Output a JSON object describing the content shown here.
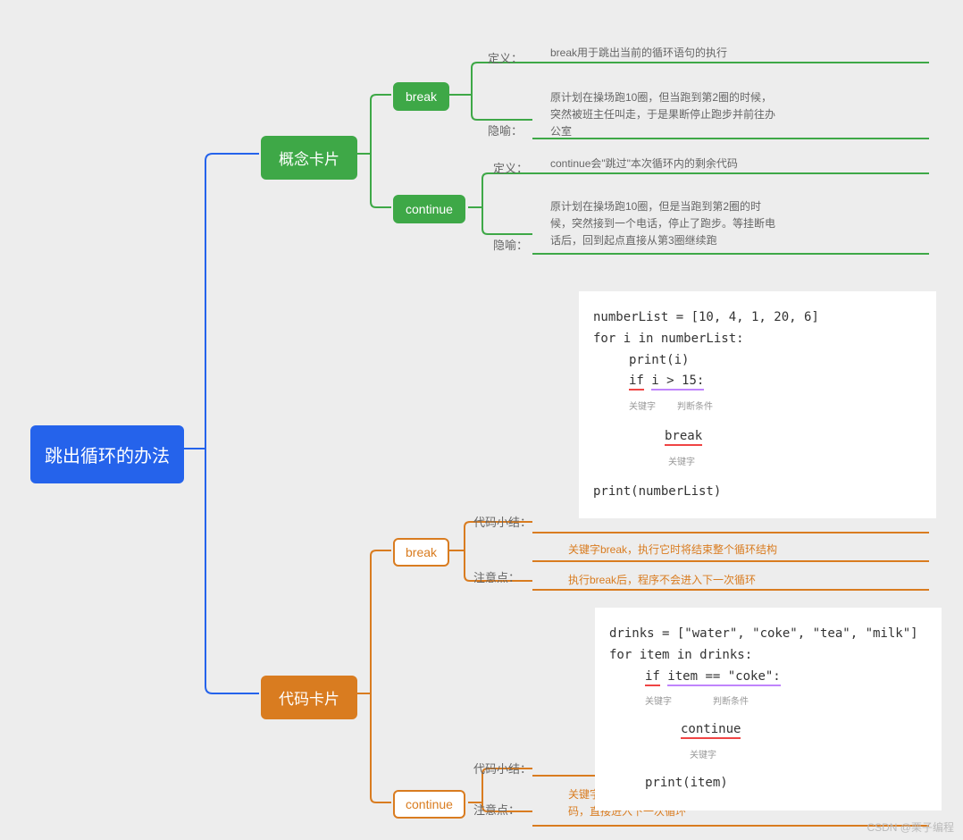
{
  "root": "跳出循环的办法",
  "concept": {
    "title": "概念卡片",
    "break": {
      "name": "break",
      "defLabel": "定义：",
      "def": "break用于跳出当前的循环语句的执行",
      "metaLabel": "隐喻：",
      "meta": "原计划在操场跑10圈，但当跑到第2圈的时候，突然被班主任叫走，于是果断停止跑步并前往办公室"
    },
    "cont": {
      "name": "continue",
      "defLabel": "定义：",
      "def": "continue会\"跳过\"本次循环内的剩余代码",
      "metaLabel": "隐喻：",
      "meta": "原计划在操场跑10圈，但是当跑到第2圈的时候，突然接到一个电话，停止了跑步。等挂断电话后，回到起点直接从第3圈继续跑"
    }
  },
  "code": {
    "title": "代码卡片",
    "break": {
      "name": "break",
      "sumLabel": "代码小结：",
      "noteLabel": "注意点：",
      "note1": "关键字break，执行它时将结束整个循环结构",
      "note2": "执行break后，程序不会进入下一次循环",
      "code": {
        "l1": "numberList = [10, 4, 1, 20, 6]",
        "l2": "for i in numberList:",
        "l3": "print(i)",
        "l4_if": "if",
        "l4_cond": "i > 15:",
        "a1": "关键字",
        "a2": "判断条件",
        "l5": "break",
        "a3": "关键字",
        "l6": "print(numberList)"
      }
    },
    "cont": {
      "name": "continue",
      "sumLabel": "代码小结：",
      "noteLabel": "注意点：",
      "note1": "关键字continue，它会跳过本次循环中后面的剩余代码，直接进入下一次循环",
      "code": {
        "l1": "drinks = [\"water\", \"coke\", \"tea\", \"milk\"]",
        "l2": "for item in drinks:",
        "l3_if": "if",
        "l3_cond": "item == \"coke\":",
        "a1": "关键字",
        "a2": "判断条件",
        "l4": "continue",
        "a3": "关键字",
        "l5": "print(item)"
      }
    }
  },
  "watermark": "CSDN @栗子编程"
}
